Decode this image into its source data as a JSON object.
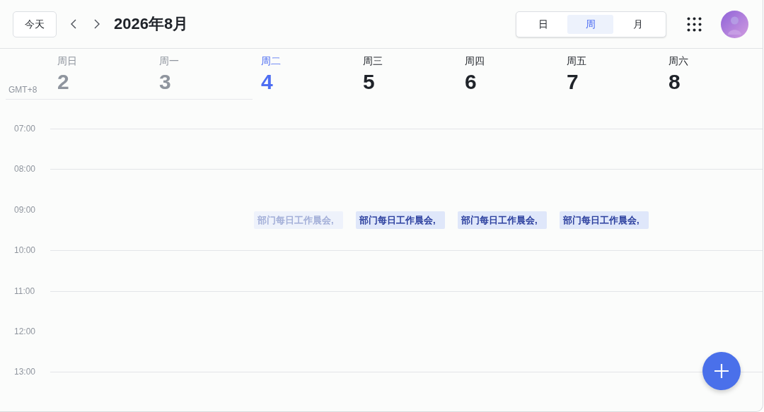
{
  "toolbar": {
    "today_button": "今天",
    "title": "2026年8月",
    "views": [
      {
        "label": "日",
        "selected": false
      },
      {
        "label": "周",
        "selected": true
      },
      {
        "label": "月",
        "selected": false
      }
    ]
  },
  "timezone": "GMT+8",
  "days": [
    {
      "weekday": "周日",
      "date": "2",
      "kind": "past"
    },
    {
      "weekday": "周一",
      "date": "3",
      "kind": "past"
    },
    {
      "weekday": "周二",
      "date": "4",
      "kind": "today",
      "events": [
        {
          "title": "部门每日工作晨会,",
          "past": true
        }
      ]
    },
    {
      "weekday": "周三",
      "date": "5",
      "kind": "future",
      "events": [
        {
          "title": "部门每日工作晨会,",
          "past": false
        }
      ]
    },
    {
      "weekday": "周四",
      "date": "6",
      "kind": "future",
      "events": [
        {
          "title": "部门每日工作晨会,",
          "past": false
        }
      ]
    },
    {
      "weekday": "周五",
      "date": "7",
      "kind": "future",
      "events": [
        {
          "title": "部门每日工作晨会,",
          "past": false
        }
      ]
    },
    {
      "weekday": "周六",
      "date": "8",
      "kind": "future"
    }
  ],
  "time_slots": [
    {
      "label": "07:00",
      "gridline": true
    },
    {
      "label": "08:00",
      "gridline": true
    },
    {
      "label": "09:00",
      "gridline": false
    },
    {
      "label": "10:00",
      "gridline": true
    },
    {
      "label": "11:00",
      "gridline": true
    },
    {
      "label": "12:00",
      "gridline": false
    },
    {
      "label": "13:00",
      "gridline": true
    }
  ]
}
